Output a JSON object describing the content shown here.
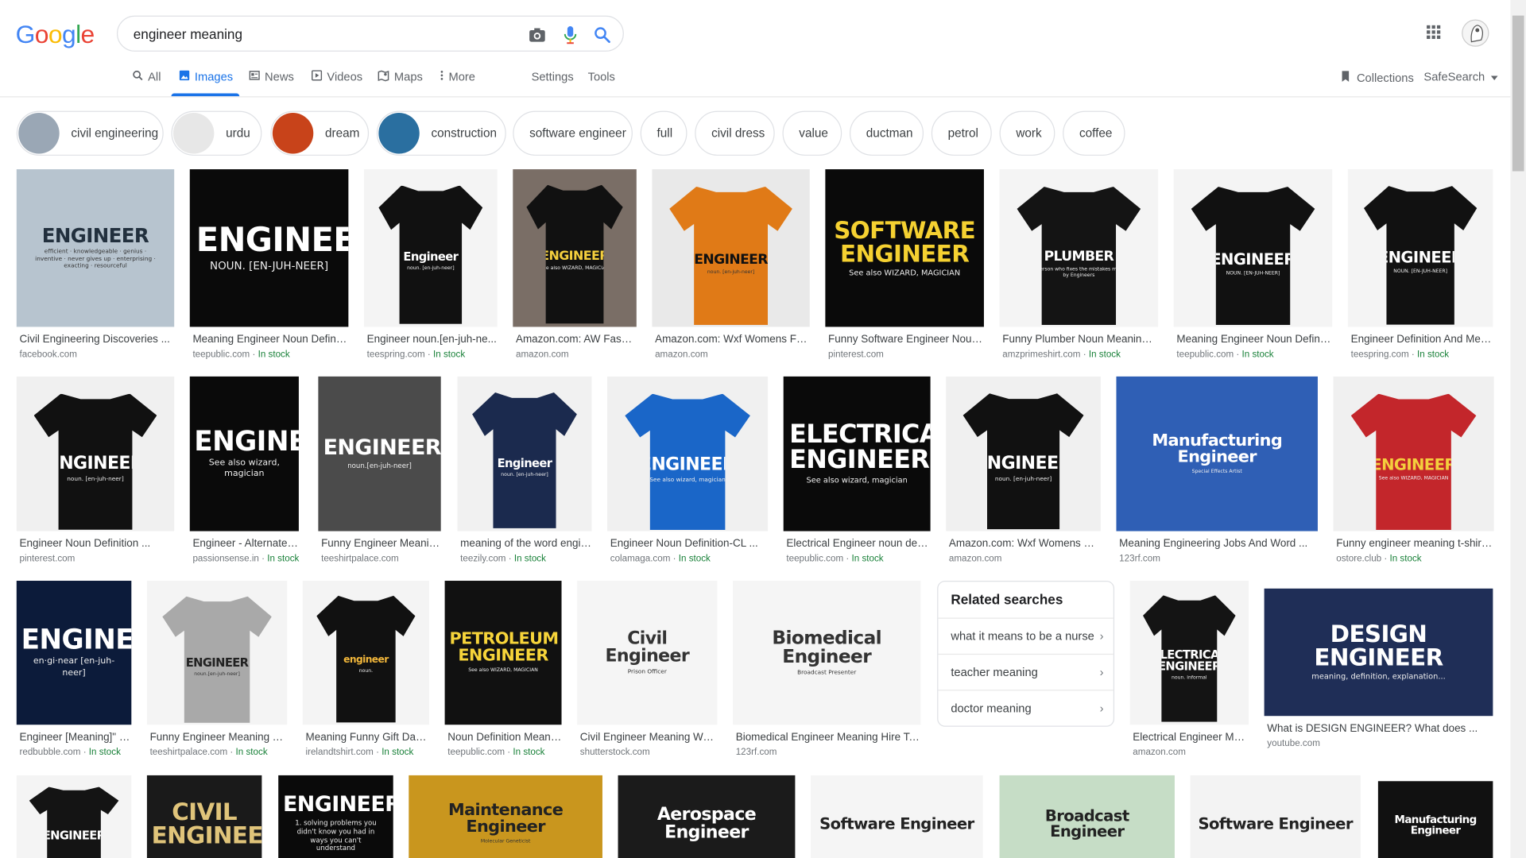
{
  "header": {
    "logo": "Google",
    "query": "engineer meaning"
  },
  "tabs": [
    {
      "label": "All",
      "icon": "search-icon"
    },
    {
      "label": "Images",
      "icon": "image-icon",
      "active": true
    },
    {
      "label": "News",
      "icon": "news-icon"
    },
    {
      "label": "Videos",
      "icon": "video-icon"
    },
    {
      "label": "Maps",
      "icon": "map-icon"
    },
    {
      "label": "More",
      "icon": "more-vert-icon"
    },
    {
      "label": "Settings"
    },
    {
      "label": "Tools"
    }
  ],
  "right_tools": {
    "collections": "Collections",
    "safesearch": "SafeSearch"
  },
  "chips": [
    "civil engineering",
    "urdu",
    "dream",
    "construction",
    "software engineer",
    "full",
    "civil dress",
    "value",
    "ductman",
    "petrol",
    "work",
    "coffee"
  ],
  "results": [
    {
      "caption": "Civil Engineering Discoveries ...",
      "source": "facebook.com",
      "stock": "",
      "art": {
        "title": "ENGINEER",
        "sub": "efficient · knowledgeable · genius · inventive · never gives up · enterprising · exacting · resourceful"
      }
    },
    {
      "caption": "Meaning Engineer Noun Definiti...",
      "source": "teepublic.com",
      "stock": "In stock",
      "art": {
        "title": "ENGINEER",
        "sub": "NOUN. [EN-JUH-NEER]"
      }
    },
    {
      "caption": "Engineer noun.[en-juh-ne...",
      "source": "teespring.com",
      "stock": "In stock",
      "art": {
        "title": "Engineer",
        "sub": "noun. [en-juh-neer]"
      }
    },
    {
      "caption": "Amazon.com: AW Fashi...",
      "source": "amazon.com",
      "stock": "",
      "art": {
        "title": "ENGINEER",
        "sub": "See also WIZARD, MAGICIAN"
      }
    },
    {
      "caption": "Amazon.com: Wxf Womens Fun...",
      "source": "amazon.com",
      "stock": "",
      "art": {
        "title": "ENGINEER",
        "sub": "noun. [en-juh-neer]"
      }
    },
    {
      "caption": "Funny Software Engineer Noun ...",
      "source": "pinterest.com",
      "stock": "",
      "art": {
        "title": "SOFTWARE ENGINEER",
        "sub": "See also WIZARD, MAGICIAN"
      }
    },
    {
      "caption": "Funny Plumber Noun Meaning A...",
      "source": "amzprimeshirt.com",
      "stock": "In stock",
      "art": {
        "title": "PLUMBER",
        "sub": "A person who fixes the mistakes made by Engineers"
      }
    },
    {
      "caption": "Meaning Engineer Noun Definiti...",
      "source": "teepublic.com",
      "stock": "In stock",
      "art": {
        "title": "ENGINEER",
        "sub": "NOUN. [EN-JUH-NEER]"
      }
    },
    {
      "caption": "Engineer Definition And Mea...",
      "source": "teespring.com",
      "stock": "In stock",
      "art": {
        "title": "ENGINEER",
        "sub": "NOUN. [EN-JUH-NEER]"
      }
    },
    {
      "caption": "Engineer Noun Definition ...",
      "source": "pinterest.com",
      "stock": "",
      "art": {
        "title": "ENGINEER",
        "sub": "noun. [en-juh-neer]"
      }
    },
    {
      "caption": "Engineer - Alternate D...",
      "source": "passionsense.in",
      "stock": "In stock",
      "art": {
        "title": "ENGINEER",
        "sub": "See also wizard, magician"
      }
    },
    {
      "caption": "Funny Engineer Meanin...",
      "source": "teeshirtpalace.com",
      "stock": "",
      "art": {
        "title": "ENGINEER",
        "sub": "noun.[en-juh-neer]"
      }
    },
    {
      "caption": "meaning of the word engin...",
      "source": "teezily.com",
      "stock": "In stock",
      "art": {
        "title": "Engineer",
        "sub": "noun. [en-juh-neer]"
      }
    },
    {
      "caption": "Engineer Noun Definition-CL ...",
      "source": "colamaga.com",
      "stock": "In stock",
      "art": {
        "title": "ENGINEER",
        "sub": "See also wizard, magician"
      }
    },
    {
      "caption": "Electrical Engineer noun defi...",
      "source": "teepublic.com",
      "stock": "In stock",
      "art": {
        "title": "ELECTRICAL ENGINEER",
        "sub": "See also wizard, magician"
      }
    },
    {
      "caption": "Amazon.com: Wxf Womens Fu...",
      "source": "amazon.com",
      "stock": "",
      "art": {
        "title": "ENGINEER",
        "sub": "noun. [en-juh-neer]"
      }
    },
    {
      "caption": "Meaning Engineering Jobs And Word ...",
      "source": "123rf.com",
      "stock": "",
      "art": {
        "title": "Manufacturing Engineer",
        "sub": "Special Effects Artist"
      }
    },
    {
      "caption": "Funny engineer meaning t-shirt-...",
      "source": "ostore.club",
      "stock": "In stock",
      "art": {
        "title": "ENGINEER",
        "sub": "See also WIZARD, MAGICIAN"
      }
    },
    {
      "caption": "Engineer [Meaning]\" K...",
      "source": "redbubble.com",
      "stock": "In stock",
      "art": {
        "title": "ENGINEER",
        "sub": "en·gi·near [en-juh-neer]"
      }
    },
    {
      "caption": "Funny Engineer Meaning T-...",
      "source": "teeshirtpalace.com",
      "stock": "In stock",
      "art": {
        "title": "ENGINEER",
        "sub": "noun.[en-juh-neer]"
      }
    },
    {
      "caption": "Meaning Funny Gift Dad ...",
      "source": "irelandtshirt.com",
      "stock": "In stock",
      "art": {
        "title": "engineer",
        "sub": "noun."
      }
    },
    {
      "caption": "Noun Definition Meani...",
      "source": "teepublic.com",
      "stock": "In stock",
      "art": {
        "title": "PETROLEUM ENGINEER",
        "sub": "See also WIZARD, MAGICIAN"
      }
    },
    {
      "caption": "Civil Engineer Meaning Wor...",
      "source": "shutterstock.com",
      "stock": "",
      "art": {
        "title": "Civil Engineer",
        "sub": "Prison Officer"
      }
    },
    {
      "caption": "Biomedical Engineer Meaning Hire Tex...",
      "source": "123rf.com",
      "stock": "",
      "art": {
        "title": "Biomedical Engineer",
        "sub": "Broadcast Presenter"
      }
    },
    {
      "caption": "Electrical Engineer Me...",
      "source": "amazon.com",
      "stock": "",
      "art": {
        "title": "ELECTRICAL ENGINEER",
        "sub": "noun. informal"
      }
    },
    {
      "caption": "What is DESIGN ENGINEER? What does ...",
      "source": "youtube.com",
      "stock": "",
      "art": {
        "title": "DESIGN ENGINEER",
        "sub": "meaning, definition, explanation..."
      }
    },
    {
      "caption": "",
      "source": "",
      "stock": "",
      "art": {
        "title": "ENGINEER",
        "sub": ""
      }
    },
    {
      "caption": "",
      "source": "",
      "stock": "",
      "art": {
        "title": "CIVIL ENGINEER",
        "sub": ""
      }
    },
    {
      "caption": "",
      "source": "",
      "stock": "",
      "art": {
        "title": "ENGINEER",
        "sub": "1. solving problems you didn't know you had in ways you can't understand"
      }
    },
    {
      "caption": "",
      "source": "",
      "stock": "",
      "art": {
        "title": "Maintenance Engineer",
        "sub": "Molecular Geneticist"
      }
    },
    {
      "caption": "",
      "source": "",
      "stock": "",
      "art": {
        "title": "Aerospace Engineer",
        "sub": ""
      }
    },
    {
      "caption": "",
      "source": "",
      "stock": "",
      "art": {
        "title": "Software Engineer",
        "sub": ""
      }
    },
    {
      "caption": "",
      "source": "",
      "stock": "",
      "art": {
        "title": "Broadcast Engineer",
        "sub": ""
      }
    },
    {
      "caption": "",
      "source": "",
      "stock": "",
      "art": {
        "title": "Software Engineer",
        "sub": ""
      }
    },
    {
      "caption": "",
      "source": "",
      "stock": "",
      "art": {
        "title": "Manufacturing Engineer",
        "sub": ""
      }
    }
  ],
  "related": {
    "title": "Related searches",
    "items": [
      "what it means to be a nurse",
      "teacher meaning",
      "doctor meaning"
    ]
  },
  "colors": {
    "accent": "#1a73e8",
    "in_stock": "#188038"
  }
}
